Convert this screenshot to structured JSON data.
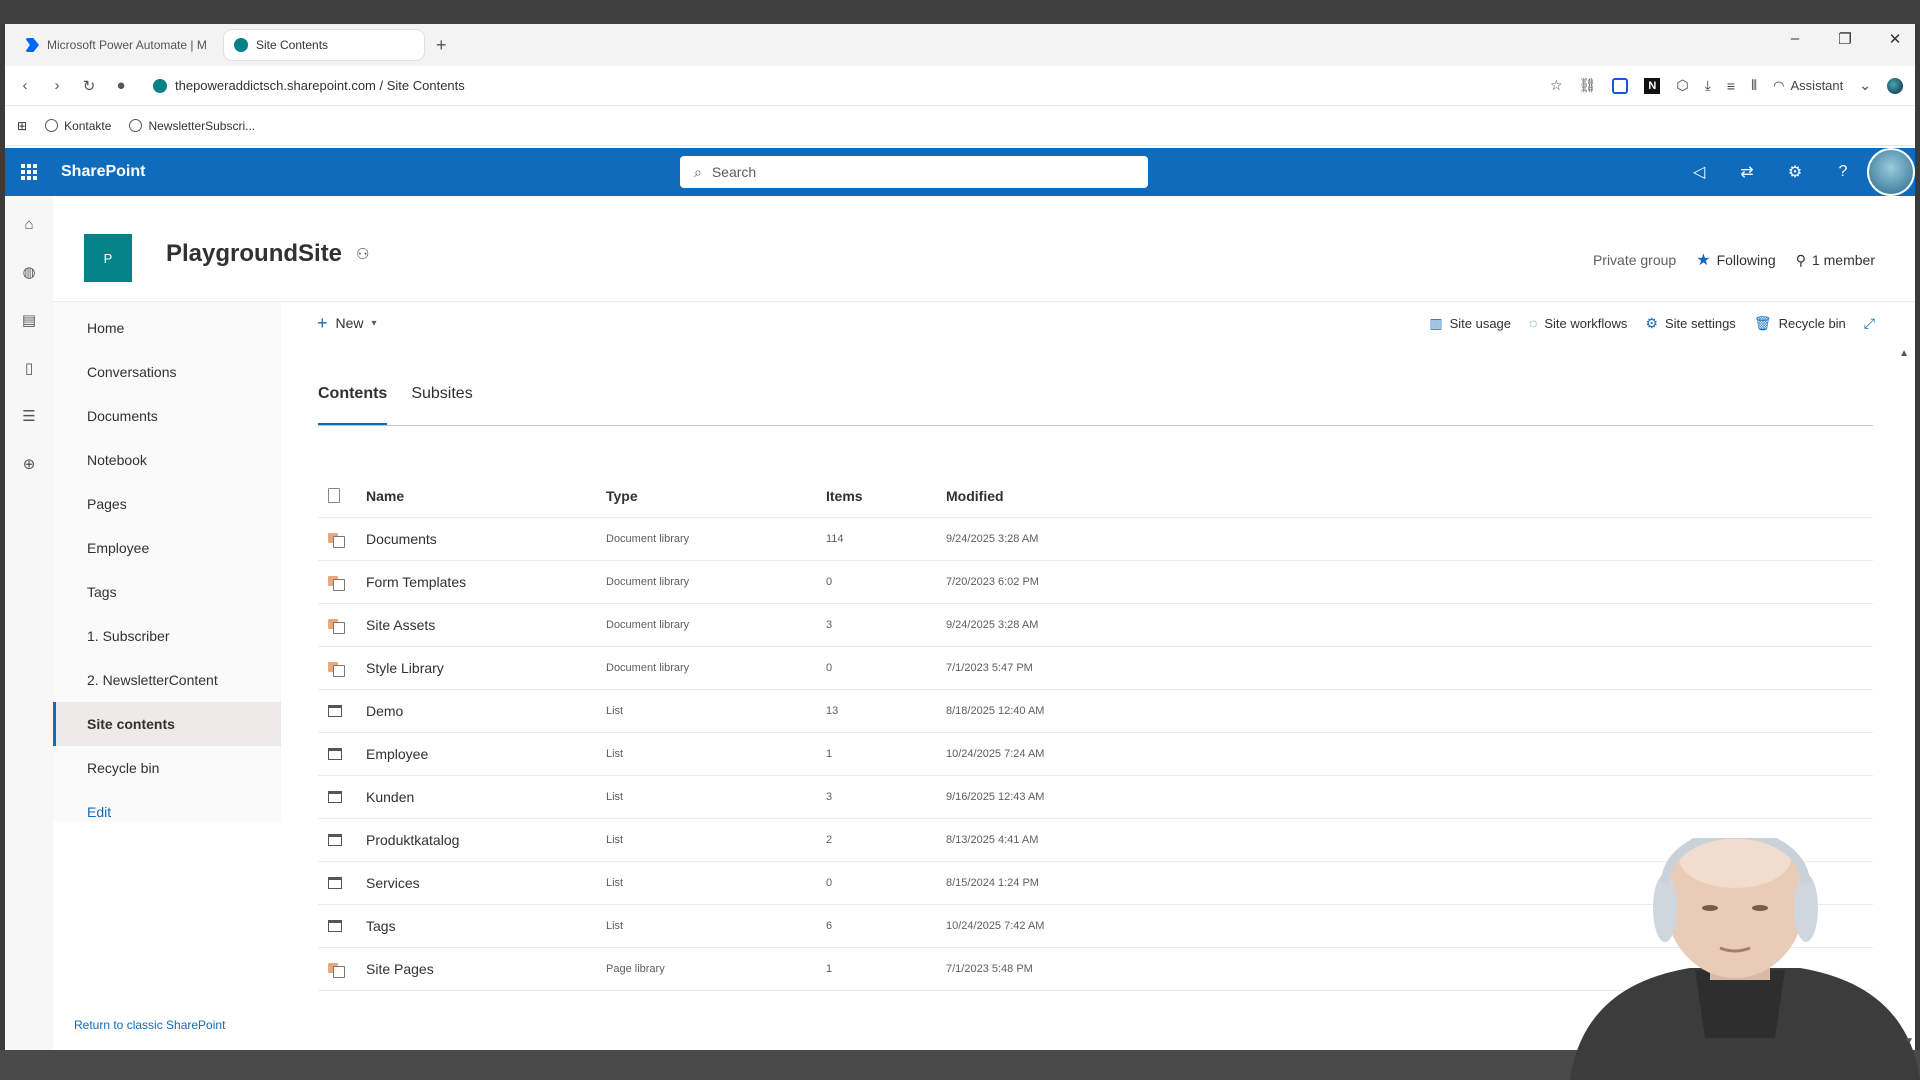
{
  "browser": {
    "tabs": [
      {
        "label": "Microsoft Power Automate | M"
      },
      {
        "label": "Site Contents"
      }
    ],
    "url": "thepoweraddictsch.sharepoint.com / Site Contents",
    "assistant_label": "Assistant",
    "bookmarks": [
      {
        "label": "Kontakte"
      },
      {
        "label": "NewsletterSubscri..."
      }
    ]
  },
  "suitebar": {
    "brand": "SharePoint",
    "search_placeholder": "Search"
  },
  "site": {
    "logo_letter": "P",
    "title": "PlaygroundSite",
    "privacy": "Private group",
    "following_label": "Following",
    "members_label": "1 member"
  },
  "leftnav": {
    "items": [
      {
        "label": "Home"
      },
      {
        "label": "Conversations"
      },
      {
        "label": "Documents"
      },
      {
        "label": "Notebook"
      },
      {
        "label": "Pages"
      },
      {
        "label": "Employee"
      },
      {
        "label": "Tags"
      },
      {
        "label": "1. Subscriber"
      },
      {
        "label": "2. NewsletterContent"
      },
      {
        "label": "Site contents"
      },
      {
        "label": "Recycle bin"
      },
      {
        "label": "Edit"
      }
    ],
    "classic_link": "Return to classic SharePoint"
  },
  "commandbar": {
    "new_label": "New",
    "site_usage": "Site usage",
    "site_workflows": "Site workflows",
    "site_settings": "Site settings",
    "recycle_bin": "Recycle bin"
  },
  "pivots": {
    "contents": "Contents",
    "subsites": "Subsites"
  },
  "table": {
    "columns": {
      "name": "Name",
      "type": "Type",
      "items": "Items",
      "modified": "Modified"
    },
    "rows": [
      {
        "icon": "library-icon",
        "name": "Documents",
        "type": "Document library",
        "items": "114",
        "modified": "9/24/2025 3:28 AM"
      },
      {
        "icon": "library-icon",
        "name": "Form Templates",
        "type": "Document library",
        "items": "0",
        "modified": "7/20/2023 6:02 PM"
      },
      {
        "icon": "library-icon",
        "name": "Site Assets",
        "type": "Document library",
        "items": "3",
        "modified": "9/24/2025 3:28 AM"
      },
      {
        "icon": "library-icon",
        "name": "Style Library",
        "type": "Document library",
        "items": "0",
        "modified": "7/1/2023 5:47 PM"
      },
      {
        "icon": "list-icon",
        "name": "Demo",
        "type": "List",
        "items": "13",
        "modified": "8/18/2025 12:40 AM"
      },
      {
        "icon": "list-icon",
        "name": "Employee",
        "type": "List",
        "items": "1",
        "modified": "10/24/2025 7:24 AM"
      },
      {
        "icon": "list-icon",
        "name": "Kunden",
        "type": "List",
        "items": "3",
        "modified": "9/16/2025 12:43 AM"
      },
      {
        "icon": "list-icon",
        "name": "Produktkatalog",
        "type": "List",
        "items": "2",
        "modified": "8/13/2025 4:41 AM"
      },
      {
        "icon": "list-icon",
        "name": "Services",
        "type": "List",
        "items": "0",
        "modified": "8/15/2024 1:24 PM"
      },
      {
        "icon": "list-icon",
        "name": "Tags",
        "type": "List",
        "items": "6",
        "modified": "10/24/2025 7:42 AM"
      },
      {
        "icon": "library-icon",
        "name": "Site Pages",
        "type": "Page library",
        "items": "1",
        "modified": "7/1/2023 5:48 PM"
      }
    ]
  }
}
